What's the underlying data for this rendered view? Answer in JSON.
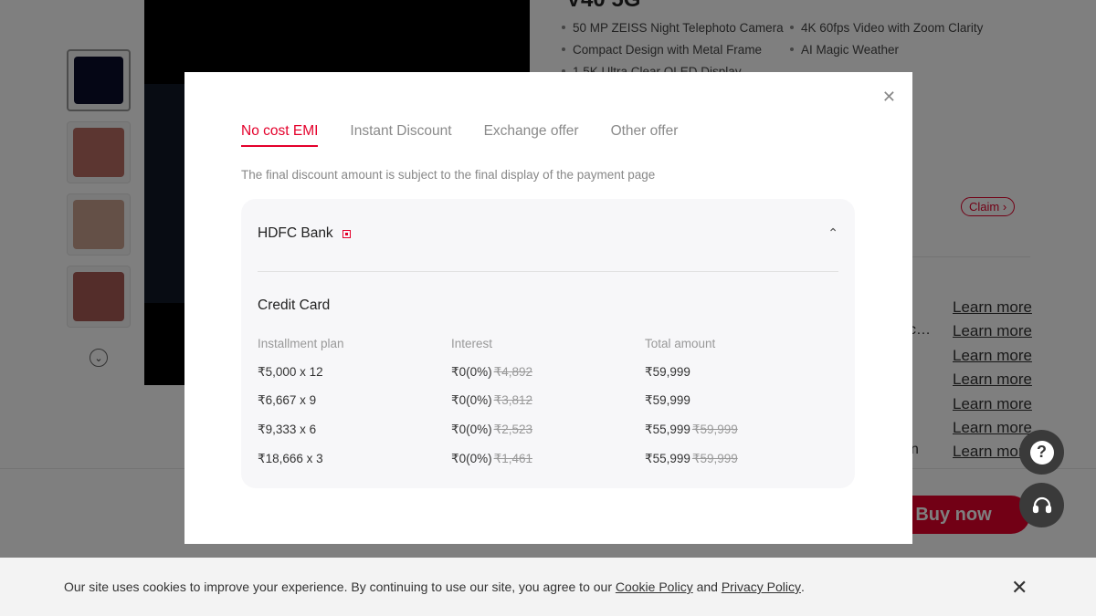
{
  "background": {
    "product_title": "V40 5G",
    "specs": [
      [
        "50 MP ZEISS Night Telephoto Camera",
        "4K 60fps Video with Zoom Clarity"
      ],
      [
        "Compact Design with Metal Frame",
        "AI Magic Weather"
      ],
      [
        "1.5K Ultra Clear OLED Display",
        ""
      ]
    ],
    "claim_label": "Claim ›",
    "learn_more_label": "Learn more",
    "learn_more_count": 7,
    "fragments": {
      "ellipsis": "c…",
      "n": "n"
    },
    "buy_now_label": "Buy now"
  },
  "modal": {
    "tabs": [
      {
        "label": "No cost EMI",
        "active": true
      },
      {
        "label": "Instant Discount",
        "active": false
      },
      {
        "label": "Exchange offer",
        "active": false
      },
      {
        "label": "Other offer",
        "active": false
      }
    ],
    "note": "The final discount amount is subject to the final display of the payment page",
    "bank": {
      "name": "HDFC Bank",
      "expanded": true,
      "card_type": "Credit Card",
      "columns": [
        "Installment plan",
        "Interest",
        "Total amount"
      ],
      "rows": [
        {
          "plan": "₹5,000 x 12",
          "interest": "₹0(0%)",
          "interest_old": "₹4,892",
          "total": "₹59,999",
          "total_old": ""
        },
        {
          "plan": "₹6,667 x 9",
          "interest": "₹0(0%)",
          "interest_old": "₹3,812",
          "total": "₹59,999",
          "total_old": ""
        },
        {
          "plan": "₹9,333 x 6",
          "interest": "₹0(0%)",
          "interest_old": "₹2,523",
          "total": "₹55,999",
          "total_old": "₹59,999"
        },
        {
          "plan": "₹18,666 x 3",
          "interest": "₹0(0%)",
          "interest_old": "₹1,461",
          "total": "₹55,999",
          "total_old": "₹59,999"
        }
      ]
    }
  },
  "cookie_bar": {
    "text_before": "Our site uses cookies to improve your experience. By continuing to use our site, you agree to our ",
    "cookie_policy": "Cookie Policy",
    "and": " and ",
    "privacy_policy": "Privacy Policy",
    "text_after": "."
  },
  "colors": {
    "accent": "#e4002b",
    "overlay": "rgba(0,0,0,0.5)",
    "fab": "#3a3a3a"
  },
  "icons": {
    "close": "close-icon",
    "chevron_up": "chevron-up-icon",
    "help": "question-icon",
    "support": "headset-icon",
    "scroll_down": "chevron-down-icon"
  }
}
